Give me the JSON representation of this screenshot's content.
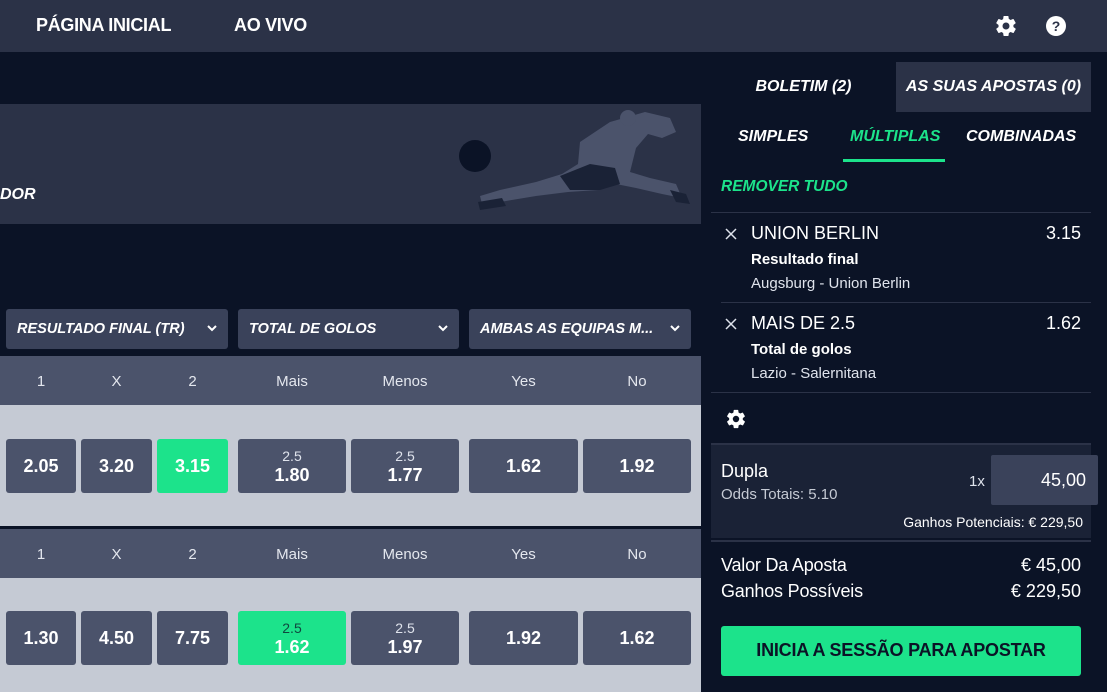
{
  "nav": {
    "home": "PÁGINA INICIAL",
    "live": "AO VIVO",
    "settings_icon": "gear-icon",
    "help_icon": "question-circle-icon"
  },
  "banner": {
    "text": "DOR"
  },
  "markets": [
    {
      "label": "RESULTADO FINAL (TR)"
    },
    {
      "label": "TOTAL DE GOLOS"
    },
    {
      "label": "AMBAS AS EQUIPAS M..."
    }
  ],
  "headers": [
    "1",
    "X",
    "2",
    "Mais",
    "Menos",
    "Yes",
    "No"
  ],
  "rows": [
    {
      "h2h": [
        "2.05",
        "3.20",
        "3.15"
      ],
      "selected": 2,
      "over": {
        "line": "2.5",
        "price": "1.80"
      },
      "under": {
        "line": "2.5",
        "price": "1.77"
      },
      "btts": [
        "1.62",
        "1.92"
      ]
    },
    {
      "h2h": [
        "1.30",
        "4.50",
        "7.75"
      ],
      "over": {
        "line": "2.5",
        "price": "1.62",
        "selected": true
      },
      "under": {
        "line": "2.5",
        "price": "1.97"
      },
      "btts": [
        "1.92",
        "1.62"
      ]
    }
  ],
  "slip": {
    "tabs": [
      "BOLETIM (2)",
      "AS SUAS APOSTAS (0)"
    ],
    "subtabs": [
      "SIMPLES",
      "MÚLTIPLAS",
      "COMBINADAS"
    ],
    "active_subtab": "MÚLTIPLAS",
    "remove_all": "REMOVER TUDO",
    "selections": [
      {
        "name": "UNION BERLIN",
        "odds": "3.15",
        "market": "Resultado final",
        "event": "Augsburg - Union Berlin"
      },
      {
        "name": "MAIS DE 2.5",
        "odds": "1.62",
        "market": "Total de golos",
        "event": "Lazio - Salernitana"
      }
    ],
    "bet_type": "Dupla",
    "total_odds": "Odds Totais: 5.10",
    "multiplier": "1x",
    "stake": "45,00",
    "potential_gains": "Ganhos Potenciais: € 229,50",
    "stake_label": "Valor Da Aposta",
    "stake_value": "€ 45,00",
    "winnings_label": "Ganhos Possíveis",
    "winnings_value": "€ 229,50",
    "cta": "INICIA A SESSÃO PARA APOSTAR"
  },
  "colors": {
    "accent": "#1ce38b",
    "bg": "#0b1326",
    "panel": "#2b3247",
    "button": "#4b536b",
    "row": "#c5cad4"
  }
}
